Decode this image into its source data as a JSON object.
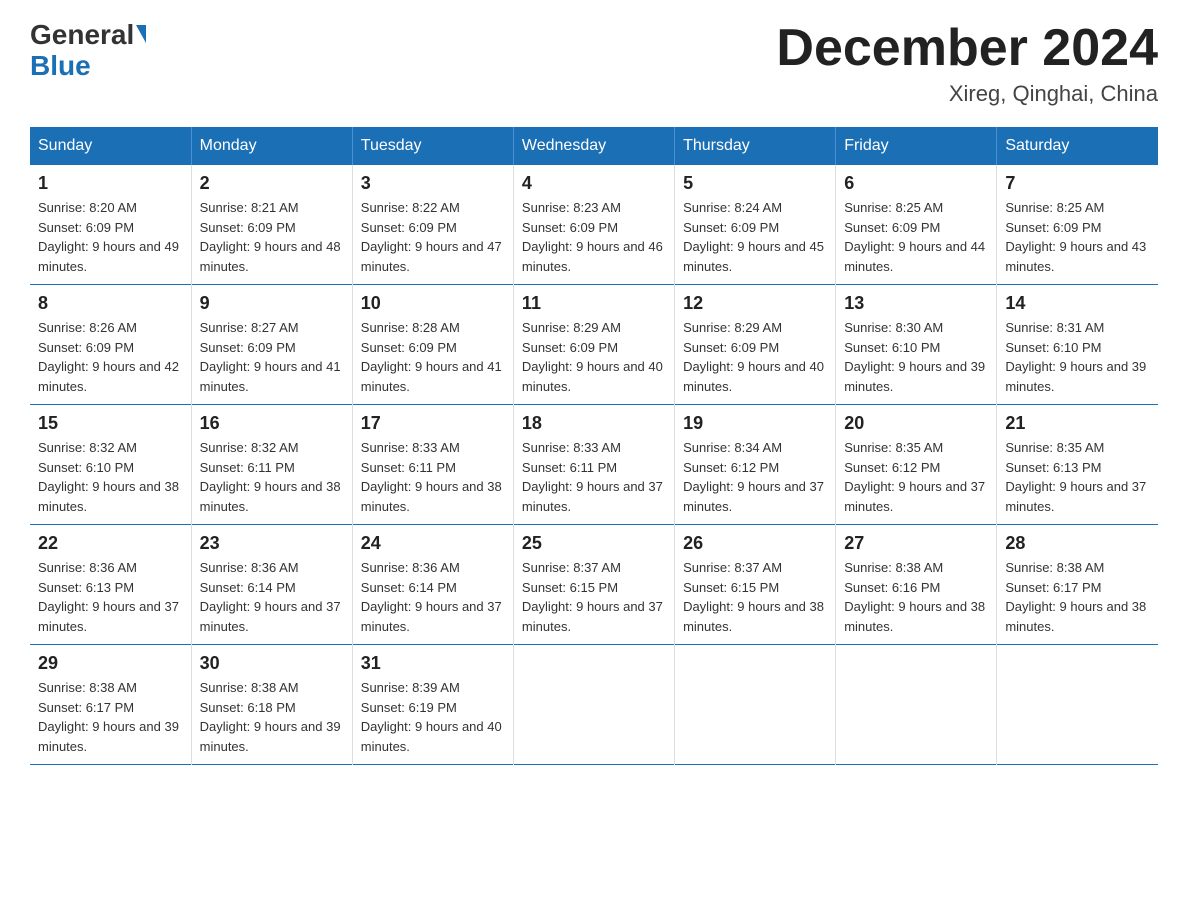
{
  "header": {
    "logo_general": "General",
    "logo_blue": "Blue",
    "month_year": "December 2024",
    "location": "Xireg, Qinghai, China"
  },
  "days_of_week": [
    "Sunday",
    "Monday",
    "Tuesday",
    "Wednesday",
    "Thursday",
    "Friday",
    "Saturday"
  ],
  "weeks": [
    [
      {
        "day": "1",
        "sunrise": "8:20 AM",
        "sunset": "6:09 PM",
        "daylight": "9 hours and 49 minutes."
      },
      {
        "day": "2",
        "sunrise": "8:21 AM",
        "sunset": "6:09 PM",
        "daylight": "9 hours and 48 minutes."
      },
      {
        "day": "3",
        "sunrise": "8:22 AM",
        "sunset": "6:09 PM",
        "daylight": "9 hours and 47 minutes."
      },
      {
        "day": "4",
        "sunrise": "8:23 AM",
        "sunset": "6:09 PM",
        "daylight": "9 hours and 46 minutes."
      },
      {
        "day": "5",
        "sunrise": "8:24 AM",
        "sunset": "6:09 PM",
        "daylight": "9 hours and 45 minutes."
      },
      {
        "day": "6",
        "sunrise": "8:25 AM",
        "sunset": "6:09 PM",
        "daylight": "9 hours and 44 minutes."
      },
      {
        "day": "7",
        "sunrise": "8:25 AM",
        "sunset": "6:09 PM",
        "daylight": "9 hours and 43 minutes."
      }
    ],
    [
      {
        "day": "8",
        "sunrise": "8:26 AM",
        "sunset": "6:09 PM",
        "daylight": "9 hours and 42 minutes."
      },
      {
        "day": "9",
        "sunrise": "8:27 AM",
        "sunset": "6:09 PM",
        "daylight": "9 hours and 41 minutes."
      },
      {
        "day": "10",
        "sunrise": "8:28 AM",
        "sunset": "6:09 PM",
        "daylight": "9 hours and 41 minutes."
      },
      {
        "day": "11",
        "sunrise": "8:29 AM",
        "sunset": "6:09 PM",
        "daylight": "9 hours and 40 minutes."
      },
      {
        "day": "12",
        "sunrise": "8:29 AM",
        "sunset": "6:09 PM",
        "daylight": "9 hours and 40 minutes."
      },
      {
        "day": "13",
        "sunrise": "8:30 AM",
        "sunset": "6:10 PM",
        "daylight": "9 hours and 39 minutes."
      },
      {
        "day": "14",
        "sunrise": "8:31 AM",
        "sunset": "6:10 PM",
        "daylight": "9 hours and 39 minutes."
      }
    ],
    [
      {
        "day": "15",
        "sunrise": "8:32 AM",
        "sunset": "6:10 PM",
        "daylight": "9 hours and 38 minutes."
      },
      {
        "day": "16",
        "sunrise": "8:32 AM",
        "sunset": "6:11 PM",
        "daylight": "9 hours and 38 minutes."
      },
      {
        "day": "17",
        "sunrise": "8:33 AM",
        "sunset": "6:11 PM",
        "daylight": "9 hours and 38 minutes."
      },
      {
        "day": "18",
        "sunrise": "8:33 AM",
        "sunset": "6:11 PM",
        "daylight": "9 hours and 37 minutes."
      },
      {
        "day": "19",
        "sunrise": "8:34 AM",
        "sunset": "6:12 PM",
        "daylight": "9 hours and 37 minutes."
      },
      {
        "day": "20",
        "sunrise": "8:35 AM",
        "sunset": "6:12 PM",
        "daylight": "9 hours and 37 minutes."
      },
      {
        "day": "21",
        "sunrise": "8:35 AM",
        "sunset": "6:13 PM",
        "daylight": "9 hours and 37 minutes."
      }
    ],
    [
      {
        "day": "22",
        "sunrise": "8:36 AM",
        "sunset": "6:13 PM",
        "daylight": "9 hours and 37 minutes."
      },
      {
        "day": "23",
        "sunrise": "8:36 AM",
        "sunset": "6:14 PM",
        "daylight": "9 hours and 37 minutes."
      },
      {
        "day": "24",
        "sunrise": "8:36 AM",
        "sunset": "6:14 PM",
        "daylight": "9 hours and 37 minutes."
      },
      {
        "day": "25",
        "sunrise": "8:37 AM",
        "sunset": "6:15 PM",
        "daylight": "9 hours and 37 minutes."
      },
      {
        "day": "26",
        "sunrise": "8:37 AM",
        "sunset": "6:15 PM",
        "daylight": "9 hours and 38 minutes."
      },
      {
        "day": "27",
        "sunrise": "8:38 AM",
        "sunset": "6:16 PM",
        "daylight": "9 hours and 38 minutes."
      },
      {
        "day": "28",
        "sunrise": "8:38 AM",
        "sunset": "6:17 PM",
        "daylight": "9 hours and 38 minutes."
      }
    ],
    [
      {
        "day": "29",
        "sunrise": "8:38 AM",
        "sunset": "6:17 PM",
        "daylight": "9 hours and 39 minutes."
      },
      {
        "day": "30",
        "sunrise": "8:38 AM",
        "sunset": "6:18 PM",
        "daylight": "9 hours and 39 minutes."
      },
      {
        "day": "31",
        "sunrise": "8:39 AM",
        "sunset": "6:19 PM",
        "daylight": "9 hours and 40 minutes."
      },
      null,
      null,
      null,
      null
    ]
  ]
}
